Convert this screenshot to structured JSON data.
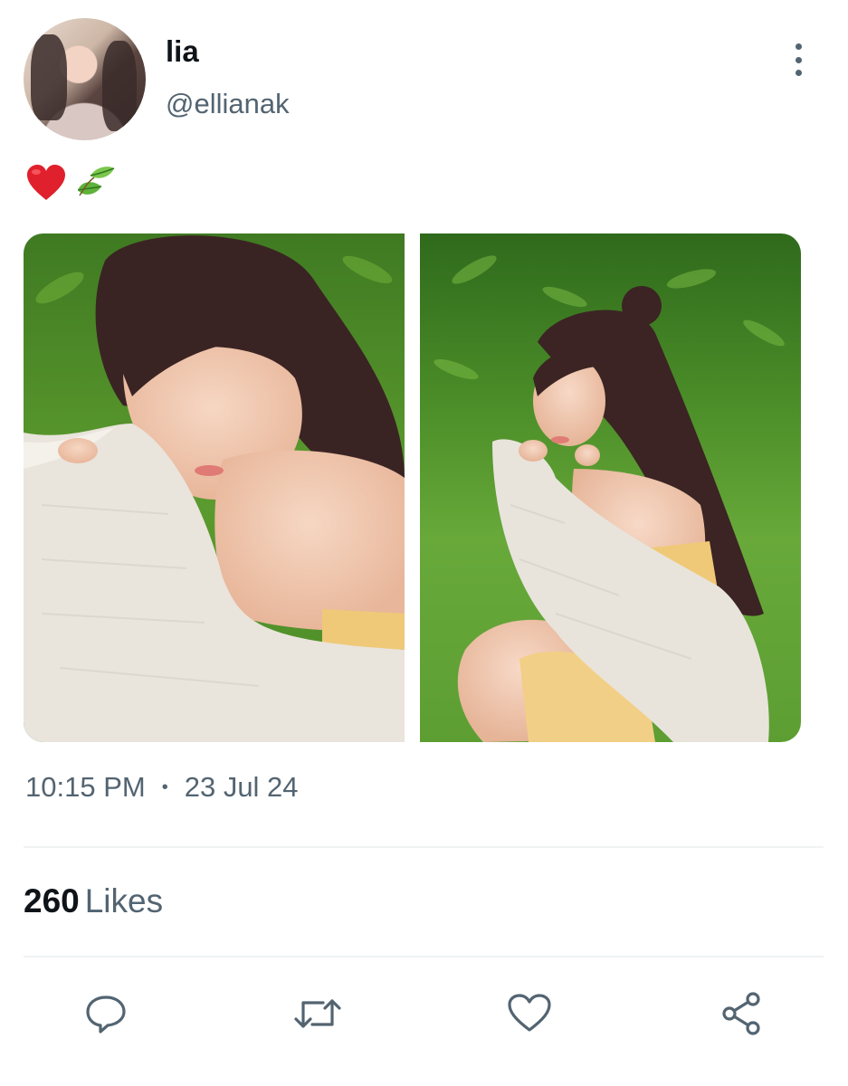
{
  "author": {
    "display_name": "lia",
    "handle": "@ellianak"
  },
  "tweet": {
    "text_emojis": [
      "heart-emoji",
      "leaf-emoji"
    ],
    "time": "10:15 PM",
    "separator": "•",
    "date": "23 Jul 24",
    "media": [
      "photo-1",
      "photo-2"
    ]
  },
  "stats": {
    "likes_count": "260",
    "likes_label": "Likes"
  },
  "actions": [
    "reply-icon",
    "retweet-icon",
    "like-icon",
    "share-icon"
  ],
  "colors": {
    "text_primary": "#0f1419",
    "text_secondary": "#536471",
    "divider": "#eff3f4"
  }
}
